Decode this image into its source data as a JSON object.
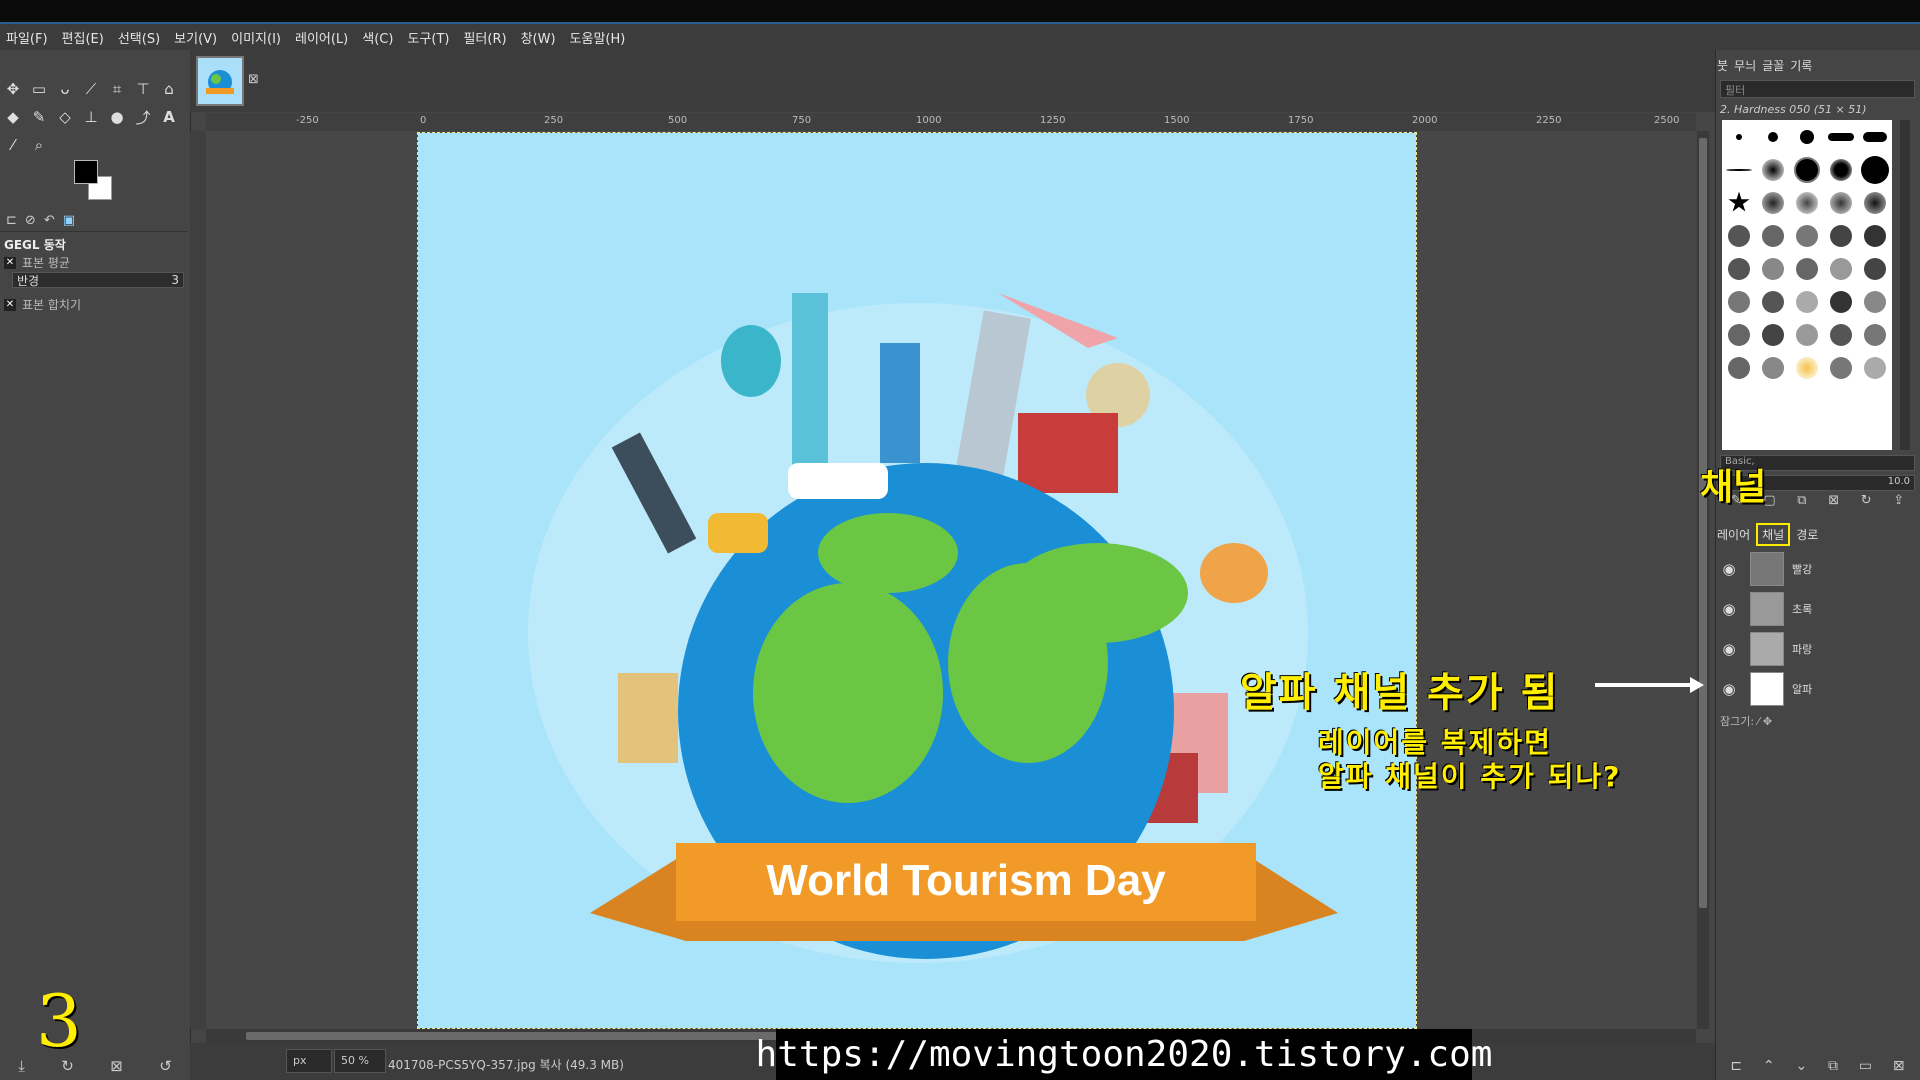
{
  "menu": [
    "파일(F)",
    "편집(E)",
    "선택(S)",
    "보기(V)",
    "이미지(I)",
    "레이어(L)",
    "색(C)",
    "도구(T)",
    "필터(R)",
    "창(W)",
    "도움말(H)"
  ],
  "tool_options": {
    "title": "GEGL 동작",
    "sample_average": "표본 평균",
    "radius_label": "반경",
    "radius_value": "3",
    "sample_merged": "표본 합치기"
  },
  "ruler": [
    "-250",
    "0",
    "250",
    "500",
    "750",
    "1000",
    "1250",
    "1500",
    "1750",
    "2000",
    "2250",
    "2500"
  ],
  "canvas": {
    "banner_text": "World Tourism Day"
  },
  "status": {
    "unit": "px",
    "zoom": "50 %",
    "file_info": "401708-PCS5YQ-357.jpg 복사 (49.3 MB)"
  },
  "watermark_url": "https://movingtoon2020.tistory.com",
  "dock": {
    "tabs": [
      "붓",
      "무늬",
      "글꼴",
      "기록"
    ],
    "filter_placeholder": "필터",
    "brush_title": "2. Hardness 050 (51 × 51)",
    "brush_preset": "Basic,",
    "spacing": "10.0",
    "panel_tabs": [
      "레이어",
      "채널",
      "경로"
    ],
    "channels": [
      "빨강",
      "초록",
      "파랑",
      "알파"
    ],
    "lock_label": "잠그기:"
  },
  "annotations": {
    "channel": "채널",
    "alpha_added": "알파 채널 추가 됨",
    "question_line1": "레이어를 복제하면",
    "question_line2": "알파 채널이 추가 되나?",
    "step": "3"
  },
  "colors": {
    "accent": "#ffee00",
    "canvas_bg": "#a9e4fa",
    "ocean": "#1b8fd6",
    "land": "#6bc644",
    "ribbon": "#f29a27"
  }
}
